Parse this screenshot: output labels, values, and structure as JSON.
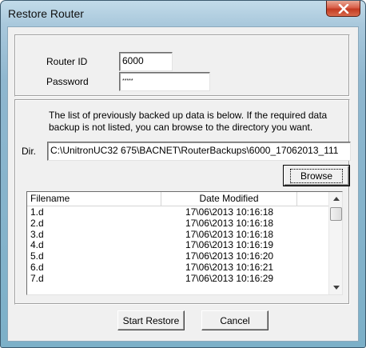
{
  "window": {
    "title": "Restore Router",
    "close_glyph": "✕"
  },
  "login": {
    "router_id_label": "Router ID",
    "router_id_value": "6000",
    "password_label": "Password",
    "password_value": "*****"
  },
  "files": {
    "info_text": "The list of previously backed up data is below. If the required data backup is not listed, you can browse to the directory you want.",
    "dir_label": "Dir.",
    "dir_value": "C:\\UnitronUC32 675\\BACNET\\RouterBackups\\6000_17062013_111",
    "browse_label": "Browse",
    "columns": [
      "Filename",
      "Date Modified"
    ],
    "rows": [
      {
        "filename": "1.d",
        "modified": "17\\06\\2013 10:16:18"
      },
      {
        "filename": "2.d",
        "modified": "17\\06\\2013 10:16:18"
      },
      {
        "filename": "3.d",
        "modified": "17\\06\\2013 10:16:18"
      },
      {
        "filename": "4.d",
        "modified": "17\\06\\2013 10:16:19"
      },
      {
        "filename": "5.d",
        "modified": "17\\06\\2013 10:16:20"
      },
      {
        "filename": "6.d",
        "modified": "17\\06\\2013 10:16:21"
      },
      {
        "filename": "7.d",
        "modified": "17\\06\\2013 10:16:29"
      }
    ]
  },
  "actions": {
    "start_restore_label": "Start Restore",
    "cancel_label": "Cancel"
  }
}
